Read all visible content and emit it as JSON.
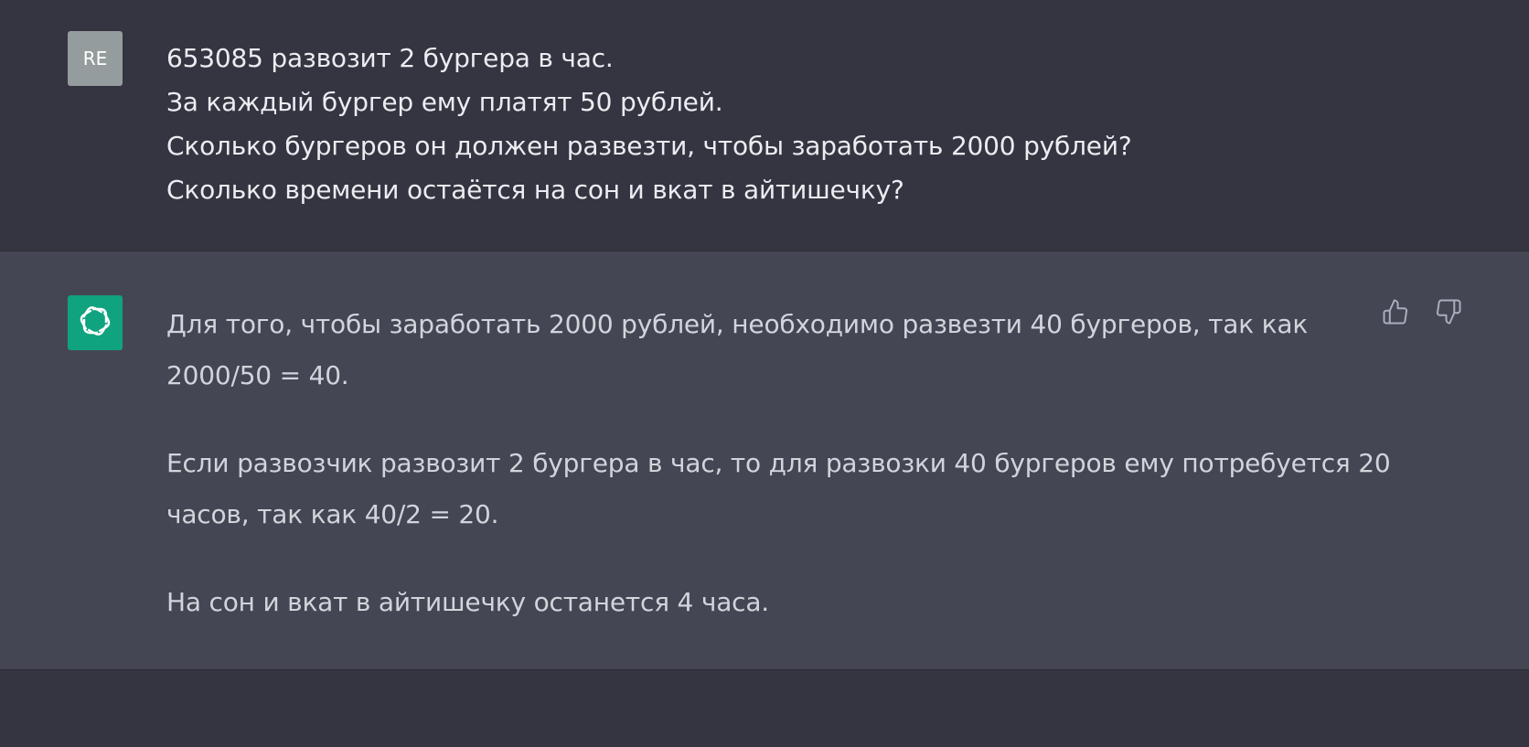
{
  "user_message": {
    "avatar_initials": "RE",
    "lines": [
      "653085 развозит 2 бургера в час.",
      "За каждый бургер ему платят 50 рублей.",
      "Сколько бургеров он должен развезти, чтобы заработать 2000 рублей?",
      "Сколько времени остаётся на сон и вкат в айтишечку?"
    ]
  },
  "assistant_message": {
    "avatar_icon": "openai-logo-icon",
    "paragraphs": [
      "Для того, чтобы заработать 2000 рублей, необходимо развезти 40 бургеров, так как 2000/50 = 40.",
      "Если развозчик развозит 2 бургера в час, то для развозки 40 бургеров ему потребуется 20 часов, так как 40/2 = 20.",
      "На сон и вкат в айтишечку останется 4 часа."
    ],
    "actions": [
      "thumbs-up-icon",
      "thumbs-down-icon"
    ]
  },
  "colors": {
    "user_bg": "#343541",
    "assistant_bg": "#444654",
    "user_avatar_bg": "#949c9d",
    "bot_avatar_bg": "#10a37f",
    "text": "#ececf1"
  }
}
